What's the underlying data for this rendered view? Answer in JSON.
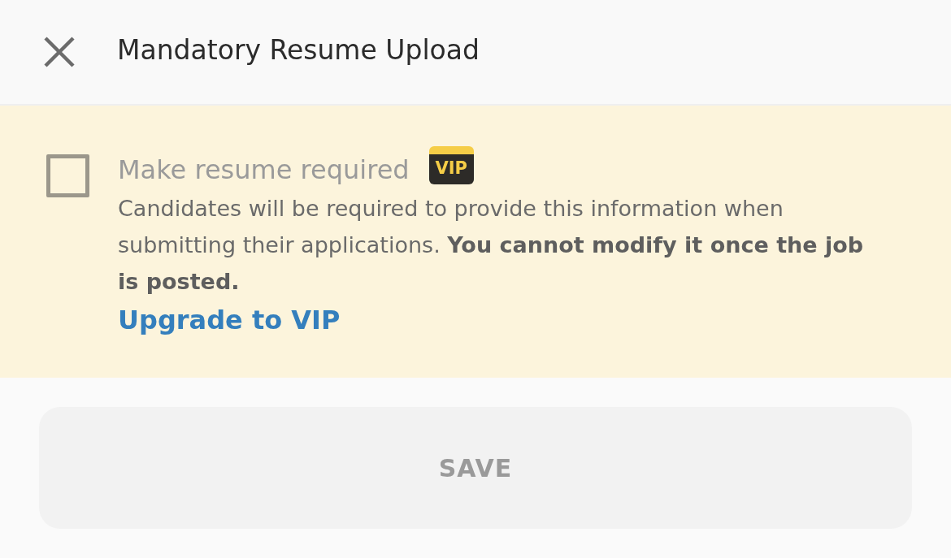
{
  "header": {
    "title": "Mandatory Resume Upload"
  },
  "option": {
    "checked": false,
    "disabled": true,
    "label": "Make resume required",
    "badge": "VIP",
    "description": "Candidates will be required to provide this information when submitting their applications. **You cannot modify it once the job is posted.**",
    "link": "Upgrade to VIP"
  },
  "save_button": {
    "label": "SAVE",
    "disabled": true
  }
}
